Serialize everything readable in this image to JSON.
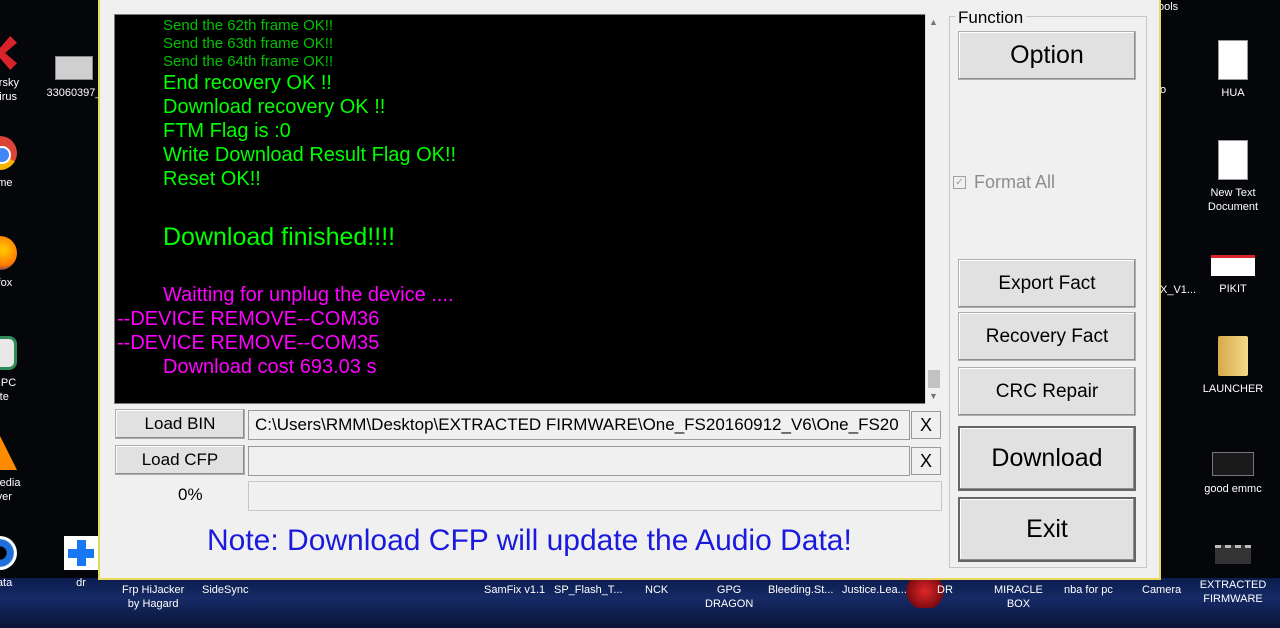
{
  "desktop": {
    "left_icons": [
      {
        "label": "spersky\nti-Virus",
        "color": "#d8232a"
      },
      {
        "label": "33060397_",
        "color": "#cfcfcf"
      },
      {
        "label": "rome",
        "color": "#3a7bd5"
      },
      {
        "label": "refox",
        "color": "#ff7a00"
      },
      {
        "label": "kia PC\nuite",
        "color": "#2e8b57"
      },
      {
        "label": "C media\nlayer",
        "color": "#ff8c00"
      },
      {
        "label": "mata",
        "color": "#1e6fd9"
      },
      {
        "label": "dr",
        "color": "#1877f2"
      }
    ],
    "right_icons": [
      {
        "label": "ools"
      },
      {
        "label": "HUA"
      },
      {
        "label": "o"
      },
      {
        "label": "New Text\nDocument"
      },
      {
        "label": "X_V1..."
      },
      {
        "label": "PIKIT"
      },
      {
        "label": "LAUNCHER"
      },
      {
        "label": "good emmc"
      },
      {
        "label": "Camera"
      },
      {
        "label": "EXTRACTED\nFIRMWARE"
      }
    ],
    "bottom_labels": [
      {
        "label": "Frp HiJacker\nby Hagard"
      },
      {
        "label": "SideSync"
      },
      {
        "label": "SamFix v1.1"
      },
      {
        "label": "SP_Flash_T..."
      },
      {
        "label": "NCK"
      },
      {
        "label": "GPG\nDRAGON"
      },
      {
        "label": "Bleeding.St..."
      },
      {
        "label": "Justice.Lea..."
      },
      {
        "label": "DR"
      },
      {
        "label": "MIRACLE\nBOX"
      },
      {
        "label": "nba for pc"
      }
    ]
  },
  "log": {
    "lines": [
      {
        "text": "Send the 62th frame OK!!",
        "color": "#00c000"
      },
      {
        "text": "Send the 63th frame OK!!",
        "color": "#00c000"
      },
      {
        "text": "Send the 64th frame OK!!",
        "color": "#00c000"
      },
      {
        "text": "End recovery OK !!",
        "color": "#00ff00"
      },
      {
        "text": "Download recovery OK !!",
        "color": "#00ff00"
      },
      {
        "text": "FTM Flag is :0",
        "color": "#00ff00"
      },
      {
        "text": "Write Download Result Flag OK!!",
        "color": "#00ff00"
      },
      {
        "text": "Reset OK!!",
        "color": "#00ff00"
      },
      {
        "text": "Download finished!!!!",
        "color": "#00ff00"
      },
      {
        "text": "Waitting for unplug the device ....",
        "color": "#ff00ff"
      },
      {
        "text": "--DEVICE REMOVE--COM36",
        "color": "#ff00ff"
      },
      {
        "text": "--DEVICE REMOVE--COM35",
        "color": "#ff00ff"
      },
      {
        "text": "Download cost 693.03 s",
        "color": "#ff00ff"
      }
    ]
  },
  "load": {
    "bin_label": "Load BIN",
    "bin_path": "C:\\Users\\RMM\\Desktop\\EXTRACTED FIRMWARE\\One_FS20160912_V6\\One_FS20",
    "cfp_label": "Load CFP",
    "cfp_path": "",
    "clear_label": "X"
  },
  "progress": {
    "text": "0%",
    "value": 0
  },
  "note": {
    "text": "Note: Download CFP will update the Audio Data!",
    "color": "#1a1adc"
  },
  "function": {
    "title": "Function",
    "option": "Option",
    "format_all": "Format All",
    "format_all_checked": true,
    "export_fact": "Export Fact",
    "recovery_fact": "Recovery Fact",
    "crc_repair": "CRC Repair",
    "download": "Download",
    "exit": "Exit"
  }
}
